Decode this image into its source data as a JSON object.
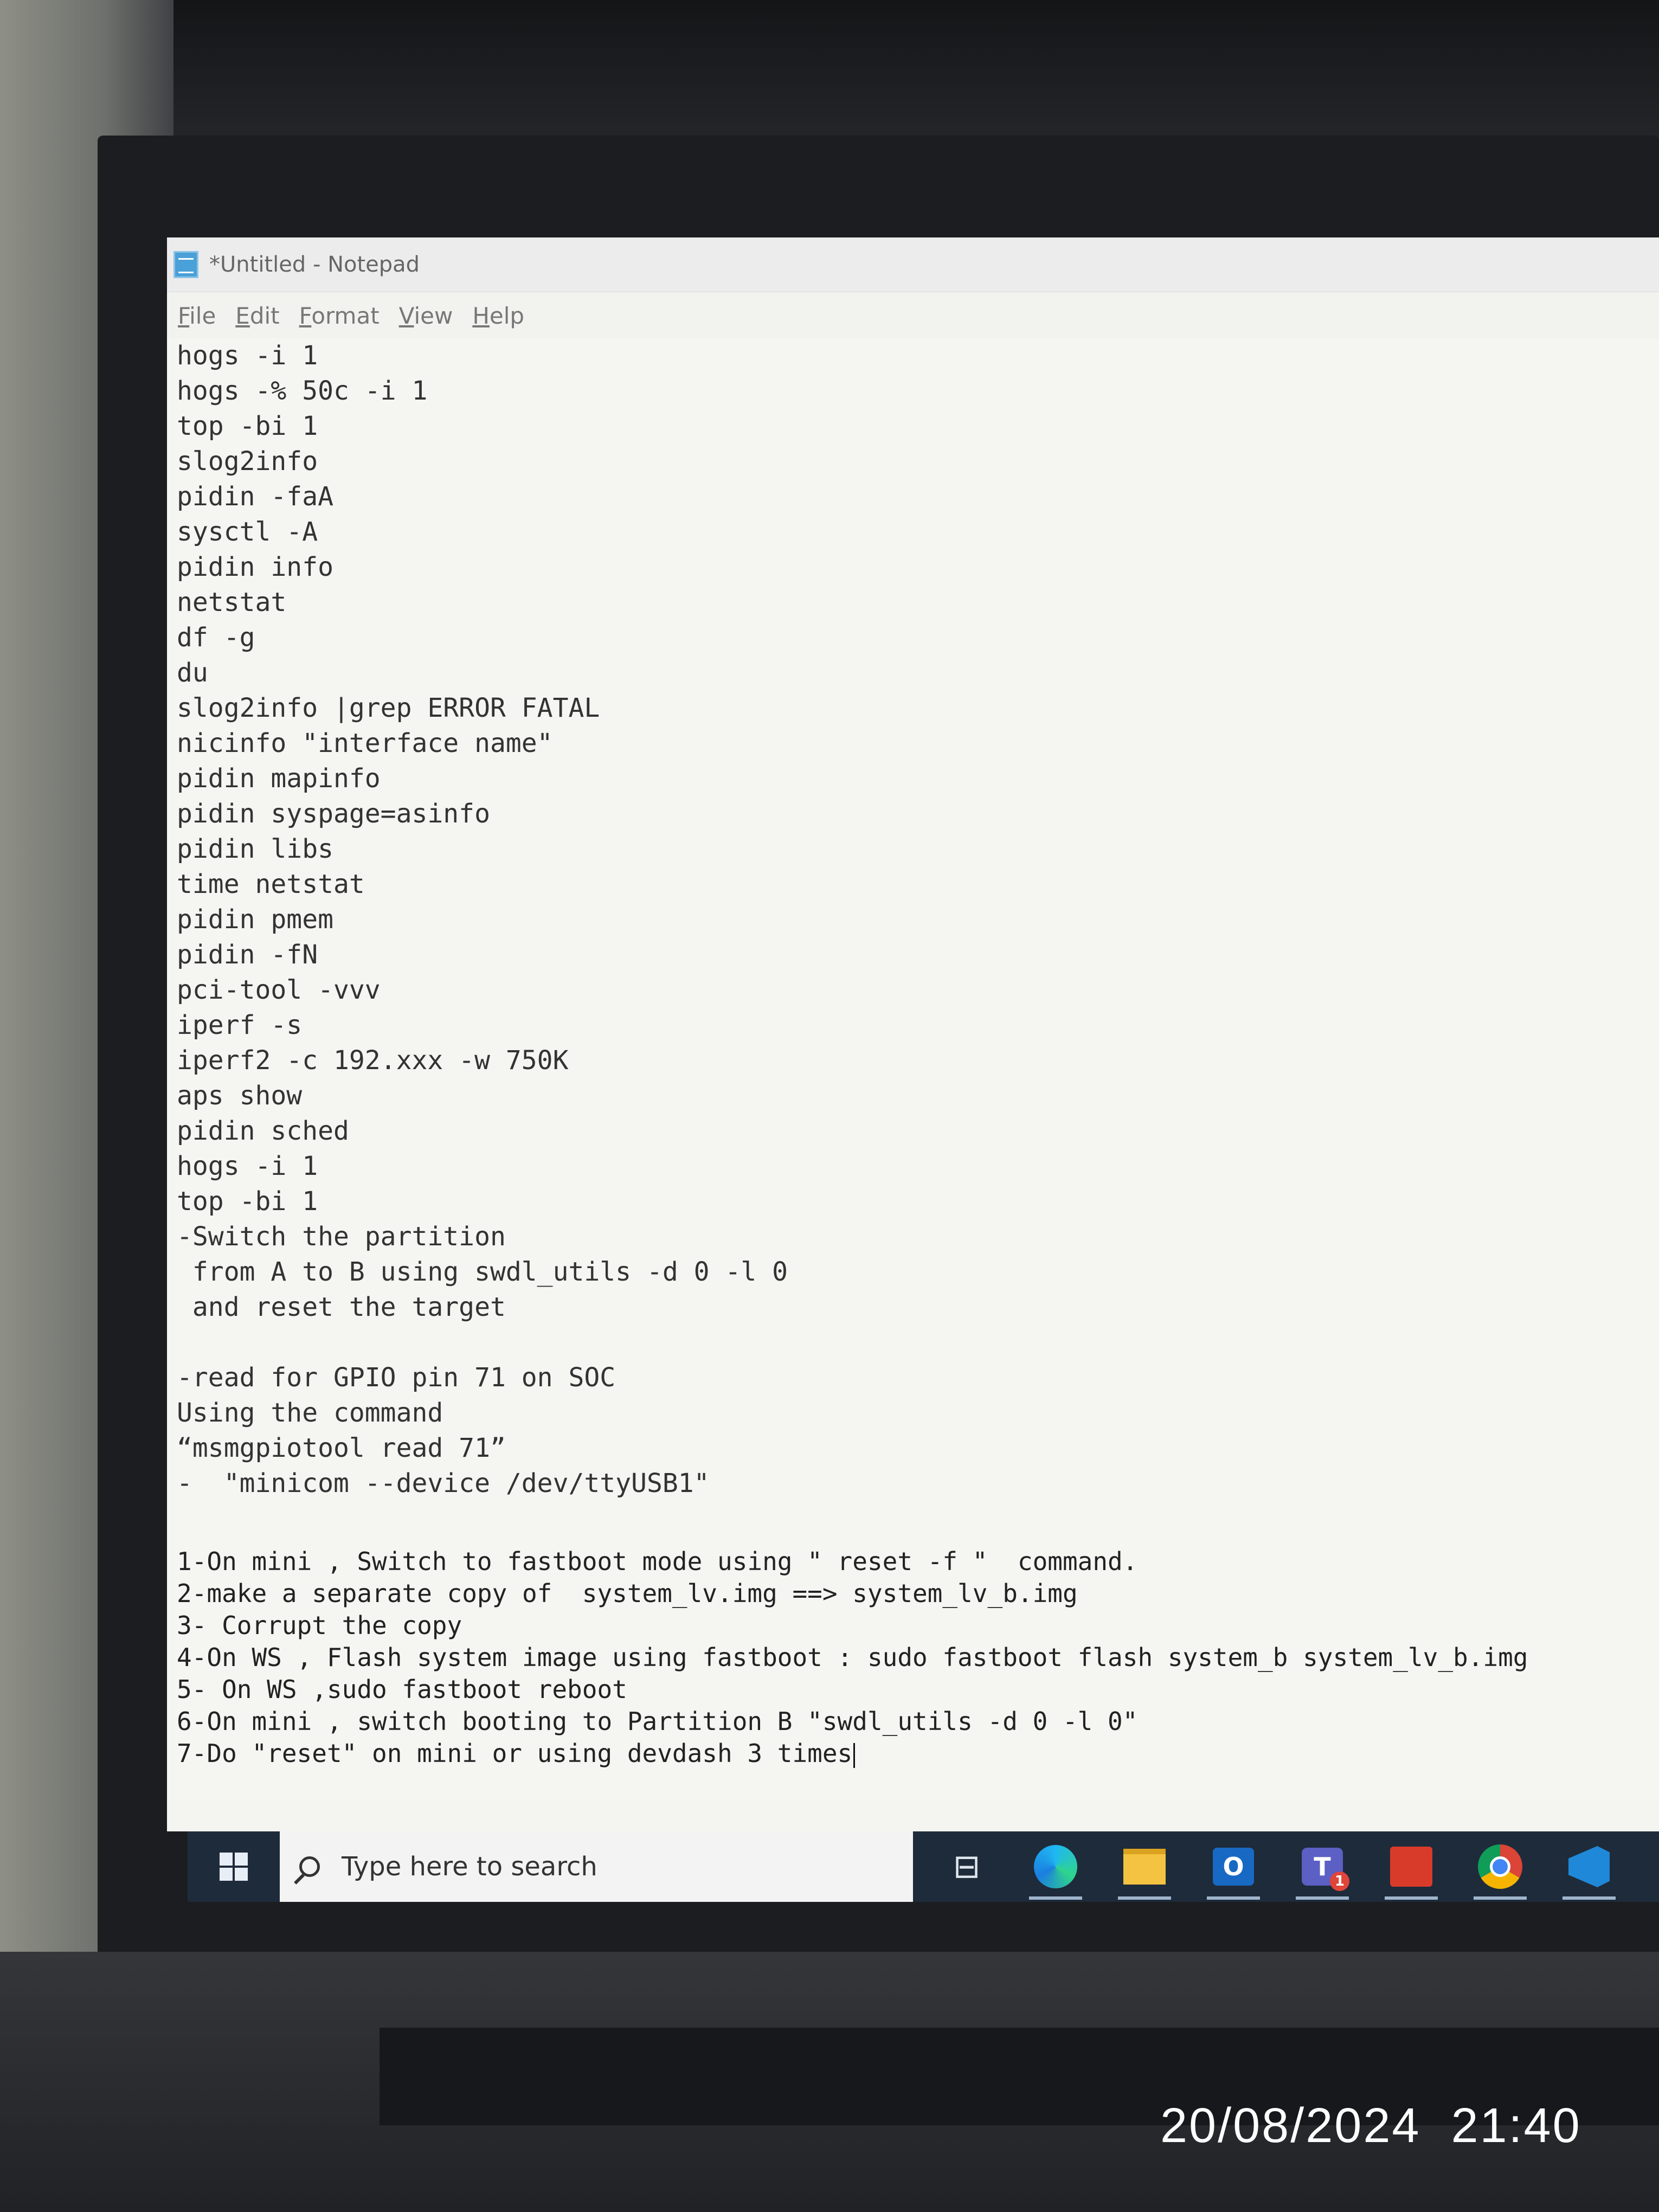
{
  "window": {
    "title": "*Untitled - Notepad"
  },
  "menu": [
    "File",
    "Edit",
    "Format",
    "View",
    "Help"
  ],
  "editor": {
    "lines": [
      "hogs -i 1",
      "hogs -% 50c -i 1",
      "top -bi 1",
      "slog2info",
      "pidin -faA",
      "sysctl -A",
      "pidin info",
      "netstat",
      "df -g",
      "du",
      "slog2info |grep ERROR FATAL",
      "nicinfo \"interface name\"",
      "pidin mapinfo",
      "pidin syspage=asinfo",
      "pidin libs",
      "time netstat",
      "pidin pmem",
      "pidin -fN",
      "pci-tool -vvv",
      "iperf -s",
      "iperf2 -c 192.xxx -w 750K",
      "aps show",
      "pidin sched",
      "hogs -i 1",
      "top -bi 1",
      "-Switch the partition",
      " from A to B using swdl_utils -d 0 -l 0",
      " and reset the target",
      "",
      "-read for GPIO pin 71 on SOC",
      "Using the command",
      "“msmgpiotool read 71”",
      "-  \"minicom --device /dev/ttyUSB1\""
    ],
    "steps": [
      "1-On mini , Switch to fastboot mode using \" reset -f \"  command.",
      "2-make a separate copy of  system_lv.img ==> system_lv_b.img",
      "3- Corrupt the copy",
      "4-On WS , Flash system image using fastboot : sudo fastboot flash system_b system_lv_b.img",
      "5- On WS ,sudo fastboot reboot",
      "6-On mini , switch booting to Partition B \"swdl_utils -d 0 -l 0\"",
      "7-Do \"reset\" on mini or using devdash 3 times"
    ]
  },
  "taskbar": {
    "search_placeholder": "Type here to search",
    "teams_badge": "1",
    "icons": [
      "windows-start-icon",
      "task-view-icon",
      "edge-icon",
      "file-explorer-icon",
      "outlook-icon",
      "teams-icon",
      "red-app-icon",
      "chrome-icon",
      "vscode-icon"
    ]
  },
  "photo_timestamp": "20/08/2024  21:40"
}
